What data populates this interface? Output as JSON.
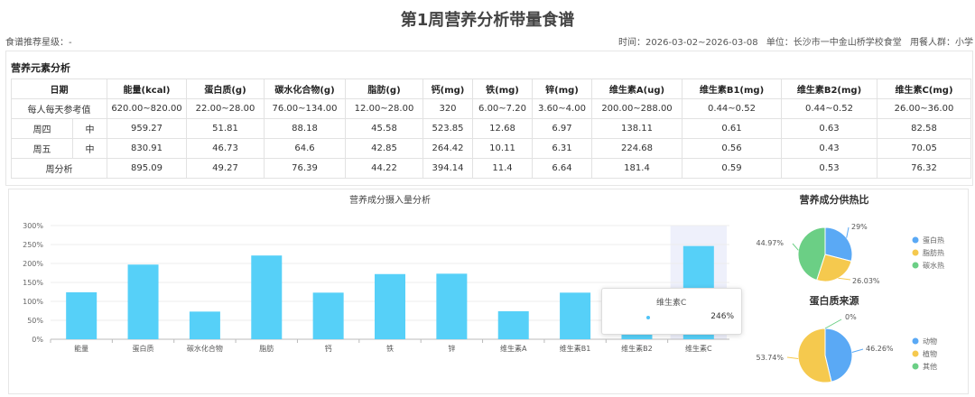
{
  "header": {
    "title": "第1周营养分析带量食谱",
    "left_label": "食谱推荐星级：-",
    "time": "时间：2026-03-02~2026-03-08",
    "unit": "单位：长沙市一中金山桥学校食堂",
    "group": "用餐人群：小学"
  },
  "table": {
    "section_title": "营养元素分析",
    "columns": [
      "日期",
      "能量(kcal)",
      "蛋白质(g)",
      "碳水化合物(g)",
      "脂肪(g)",
      "钙(mg)",
      "铁(mg)",
      "锌(mg)",
      "维生素A(ug)",
      "维生素B1(mg)",
      "维生素B2(mg)",
      "维生素C(mg)"
    ],
    "reference": {
      "label": "每人每天参考值",
      "values": [
        "620.00~820.00",
        "22.00~28.00",
        "76.00~134.00",
        "12.00~28.00",
        "320",
        "6.00~7.20",
        "3.60~4.00",
        "200.00~288.00",
        "0.44~0.52",
        "0.44~0.52",
        "26.00~36.00"
      ]
    },
    "days": [
      {
        "day": "周四",
        "meal": "中",
        "values": [
          "959.27",
          "51.81",
          "88.18",
          "45.58",
          "523.85",
          "12.68",
          "6.97",
          "138.11",
          "0.61",
          "0.63",
          "82.58"
        ]
      },
      {
        "day": "周五",
        "meal": "中",
        "values": [
          "830.91",
          "46.73",
          "64.6",
          "42.85",
          "264.42",
          "10.11",
          "6.31",
          "224.68",
          "0.56",
          "0.43",
          "70.05"
        ]
      }
    ],
    "week": {
      "label": "周分析",
      "values": [
        "895.09",
        "49.27",
        "76.39",
        "44.22",
        "394.14",
        "11.4",
        "6.64",
        "181.4",
        "0.59",
        "0.53",
        "76.32"
      ]
    }
  },
  "chart_data": [
    {
      "type": "bar",
      "title": "营养成分摄入量分析",
      "categories": [
        "能量",
        "蛋白质",
        "碳水化合物",
        "脂肪",
        "钙",
        "铁",
        "锌",
        "维生素A",
        "维生素B1",
        "维生素B2",
        "维生素C"
      ],
      "values": [
        124,
        197,
        73,
        221,
        123,
        172,
        173,
        74,
        123,
        108,
        246
      ],
      "ylim": [
        0,
        300
      ],
      "yticks": [
        "0%",
        "50%",
        "100%",
        "150%",
        "200%",
        "250%",
        "300%"
      ],
      "highlight_index": 10,
      "tooltip": {
        "label": "维生素C",
        "value": "246%"
      },
      "colors": {
        "bar": "#56d0f8",
        "highlight": "#eef0fb"
      }
    },
    {
      "type": "pie",
      "title": "营养成分供热比",
      "slices": [
        {
          "name": "蛋白热",
          "value": 29.0,
          "label": "29%",
          "color": "#5aa9f5"
        },
        {
          "name": "脂肪热",
          "value": 26.03,
          "label": "26.03%",
          "color": "#f5c94e"
        },
        {
          "name": "碳水热",
          "value": 44.97,
          "label": "44.97%",
          "color": "#6bcf85"
        }
      ],
      "legend": "right"
    },
    {
      "type": "pie",
      "title": "蛋白质来源",
      "slices": [
        {
          "name": "动物",
          "value": 46.26,
          "label": "46.26%",
          "color": "#5aa9f5"
        },
        {
          "name": "植物",
          "value": 53.74,
          "label": "53.74%",
          "color": "#f5c94e"
        },
        {
          "name": "其他",
          "value": 0,
          "label": "0%",
          "color": "#6bcf85"
        }
      ],
      "legend": "right"
    }
  ]
}
